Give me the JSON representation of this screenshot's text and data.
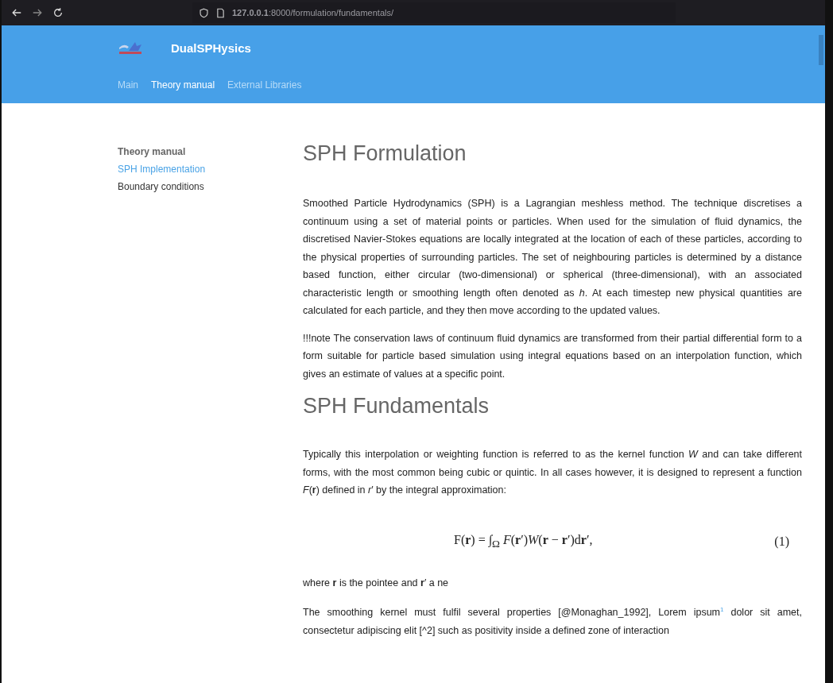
{
  "browser": {
    "url": "**127.0.0.1**:8000/formulation/fundamentals/"
  },
  "header": {
    "site_title": "DualSPHysics",
    "nav": [
      {
        "label": "Main",
        "selected": false
      },
      {
        "label": "Theory manual",
        "selected": true
      },
      {
        "label": "External Libraries",
        "selected": false
      }
    ]
  },
  "sidebar": {
    "items": [
      {
        "label": "Theory manual",
        "kind": "heading",
        "selected": false
      },
      {
        "label": "SPH Implementation",
        "kind": "link",
        "selected": true
      },
      {
        "label": "Boundary conditions",
        "kind": "link",
        "selected": false
      }
    ]
  },
  "content": [
    {
      "kind": "h1",
      "text": "SPH Formulation"
    },
    {
      "kind": "p",
      "text": "Smoothed Particle Hydrodynamics (SPH) is a Lagrangian meshless method. The technique discretises a continuum using a set of material points or particles. When used for the simulation of fluid dynamics, the discretised Navier-Stokes equations are locally integrated at the location of each of these particles, according to the physical properties of surrounding particles. The set of neighbouring particles is determined by a distance based function, either circular (two-dimensional) or spherical (three-dimensional), with an associated characteristic length or smoothing length often denoted as *h*. At each timestep new physical quantities are calculated for each particle, and they then move according to the updated values."
    },
    {
      "kind": "p",
      "text": "!!!note The conservation laws of continuum fluid dynamics are transformed from their partial differential form to a form suitable for particle based simulation using integral equations based on an interpolation function, which gives an estimate of values at a specific point."
    },
    {
      "kind": "h1",
      "text": "SPH Fundamentals"
    },
    {
      "kind": "p",
      "text": "Typically this interpolation or weighting function is referred to as the kernel function *W* and can take different forms, with the most common being cubic or quintic. In all cases however, it is designed to represent a function *F*(**r**) defined in *r*′ by the integral approximation:"
    },
    {
      "kind": "equation",
      "text": "F(**r**) = ∫$_{Ω}$ *F*(**r**′)*W*(**r** − **r**′)d**r**′,",
      "number": "(1)"
    },
    {
      "kind": "p",
      "text": "where **r** is the pointee and **r**′ a ne"
    },
    {
      "kind": "p",
      "text": "The smoothing kernel must fulfil several properties [@Monaghan_1992], Lorem ipsum$^{1}$ dolor sit amet, consectetur adipiscing elit [^2] such as positivity inside a defined zone of interaction"
    }
  ]
}
